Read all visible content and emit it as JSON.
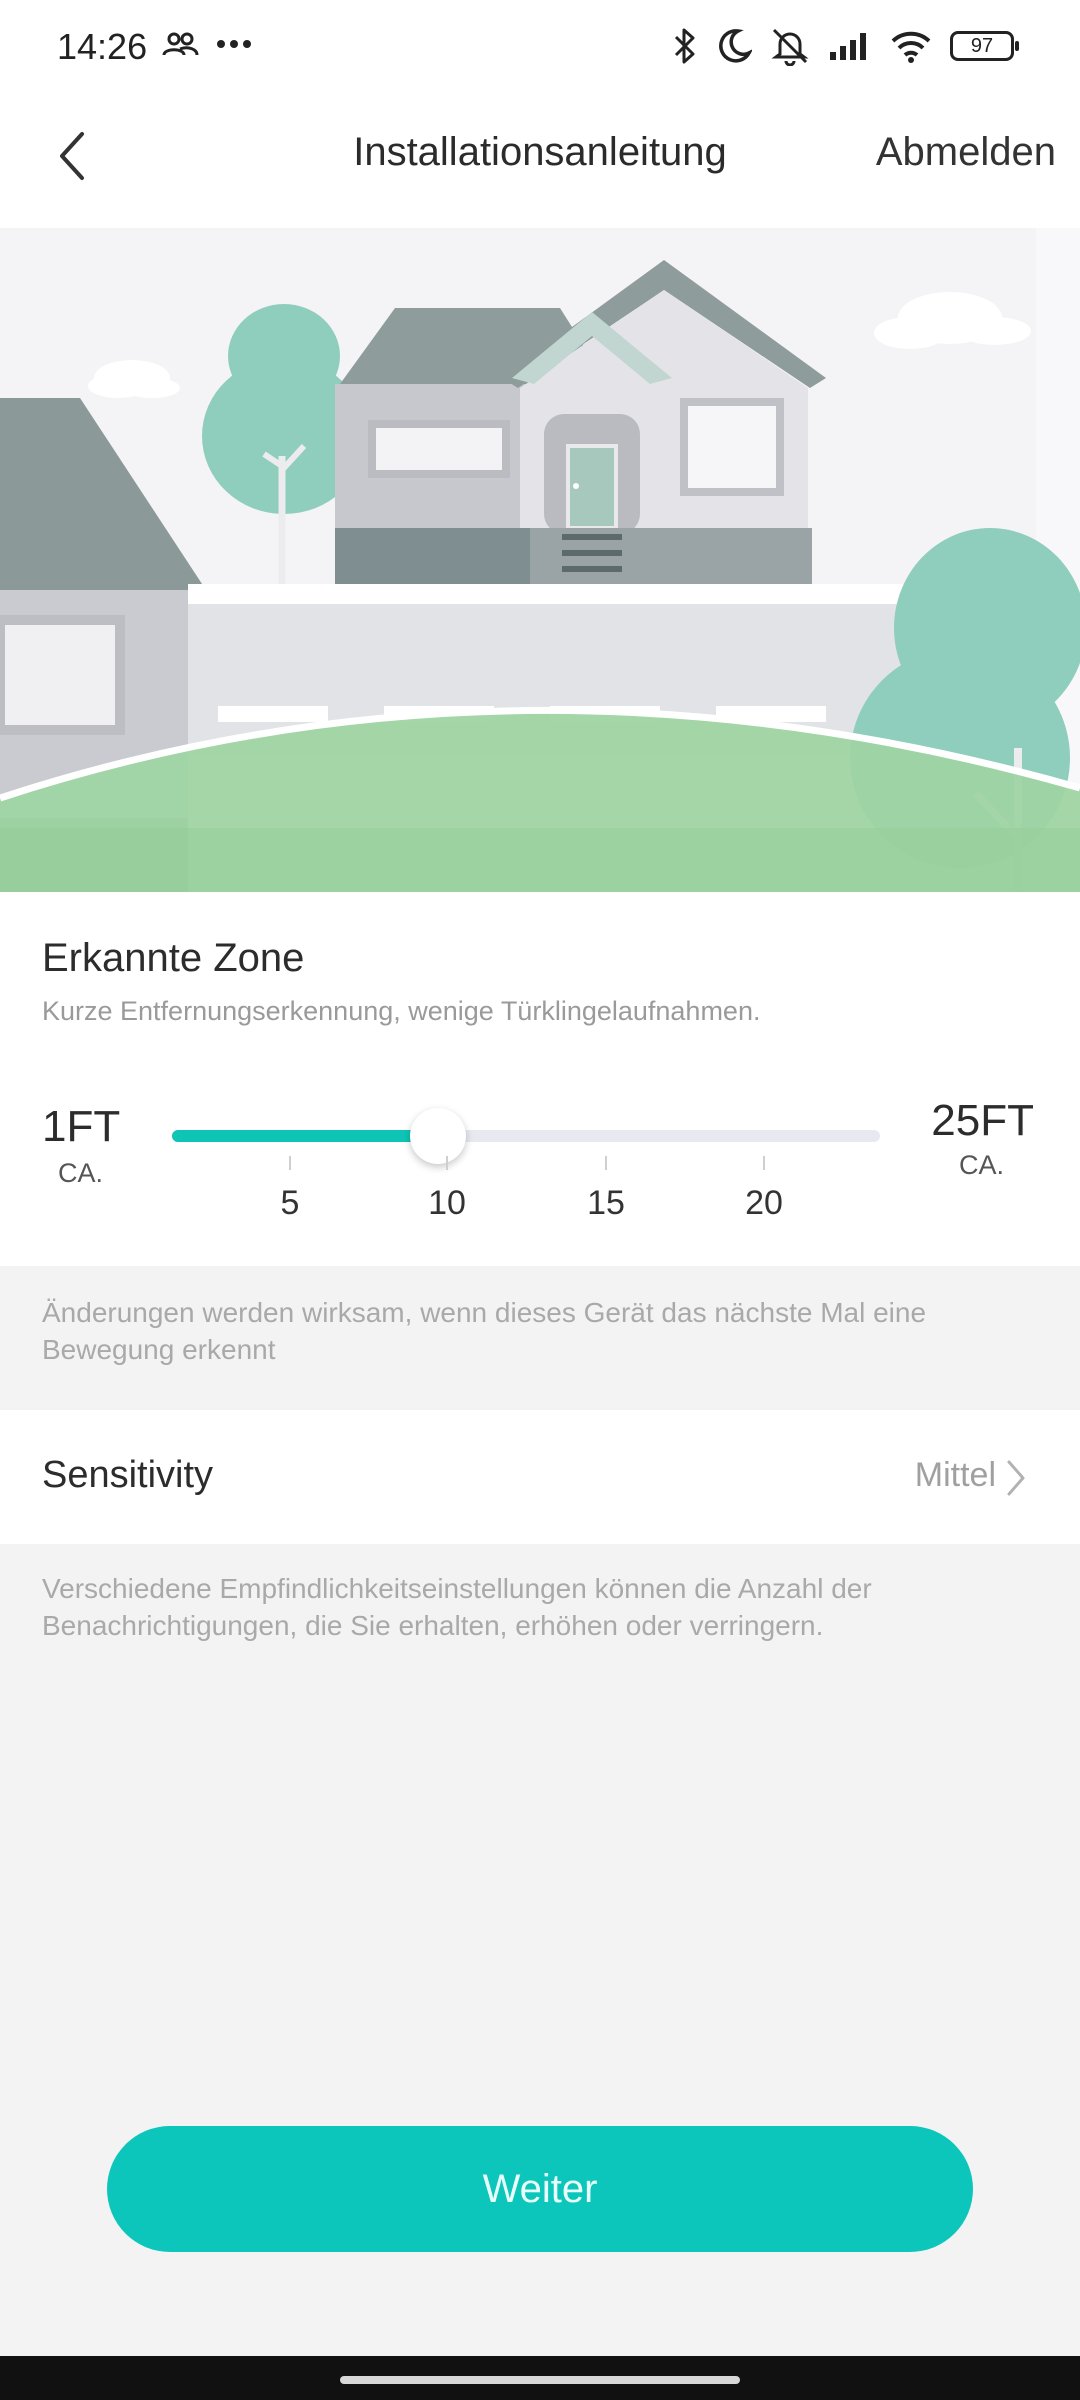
{
  "status_bar": {
    "time": "14:26",
    "battery": "97",
    "icons": [
      "people-icon",
      "more-dots-icon",
      "bluetooth-icon",
      "do-not-disturb-moon-icon",
      "muted-bell-icon",
      "signal-icon",
      "wifi-icon",
      "battery-icon"
    ]
  },
  "header": {
    "title": "Installationsanleitung",
    "logout_label": "Abmelden"
  },
  "zone": {
    "title": "Erkannte Zone",
    "subtitle": "Kurze Entfernungserkennung, wenige Türklingelaufnahmen.",
    "min_value": "1FT",
    "min_unit": "CA.",
    "max_value": "25FT",
    "max_unit": "CA.",
    "ticks": [
      "5",
      "10",
      "15",
      "20"
    ],
    "min_ft": 1,
    "max_ft": 25,
    "current_ft": 10
  },
  "notes": {
    "apply_hint": "Änderungen werden wirksam, wenn dieses Gerät das nächste Mal eine Bewegung erkennt",
    "sensitivity_hint": "Verschiedene Empfindlichkeitseinstellungen können die Anzahl der Benachrichtigungen, die Sie erhalten, erhöhen oder verringern."
  },
  "sensitivity": {
    "label": "Sensitivity",
    "value": "Mittel"
  },
  "footer": {
    "continue_label": "Weiter"
  },
  "colors": {
    "accent": "#0dc6bb",
    "slider_fill": "#0ec5b5",
    "grass": "#9fd4a3",
    "tree": "#8fcdbd"
  }
}
